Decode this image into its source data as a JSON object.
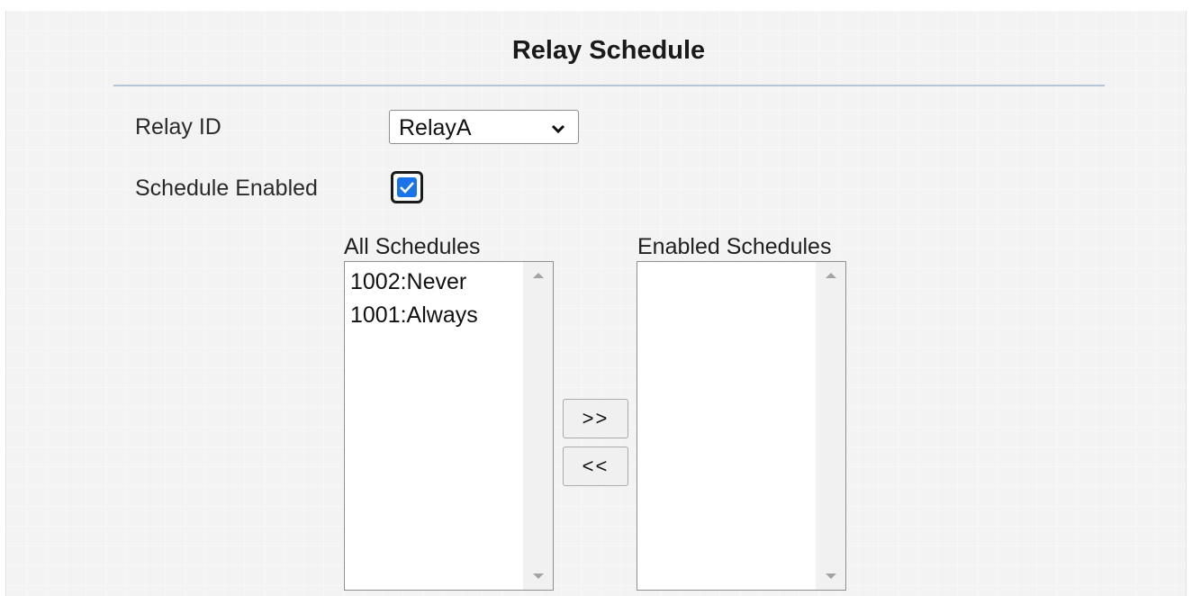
{
  "page": {
    "title": "Relay Schedule"
  },
  "form": {
    "relay_id": {
      "label": "Relay ID",
      "selected": "RelayA"
    },
    "schedule_enabled": {
      "label": "Schedule Enabled",
      "checked": true
    }
  },
  "all_schedules": {
    "caption": "All Schedules",
    "items": [
      "1002:Never",
      "1001:Always"
    ]
  },
  "enabled_schedules": {
    "caption": "Enabled Schedules",
    "items": []
  },
  "buttons": {
    "add_label": ">>",
    "remove_label": "<<"
  },
  "colors": {
    "checkbox_fill": "#1a73e8",
    "divider": "#b3c6d6"
  }
}
